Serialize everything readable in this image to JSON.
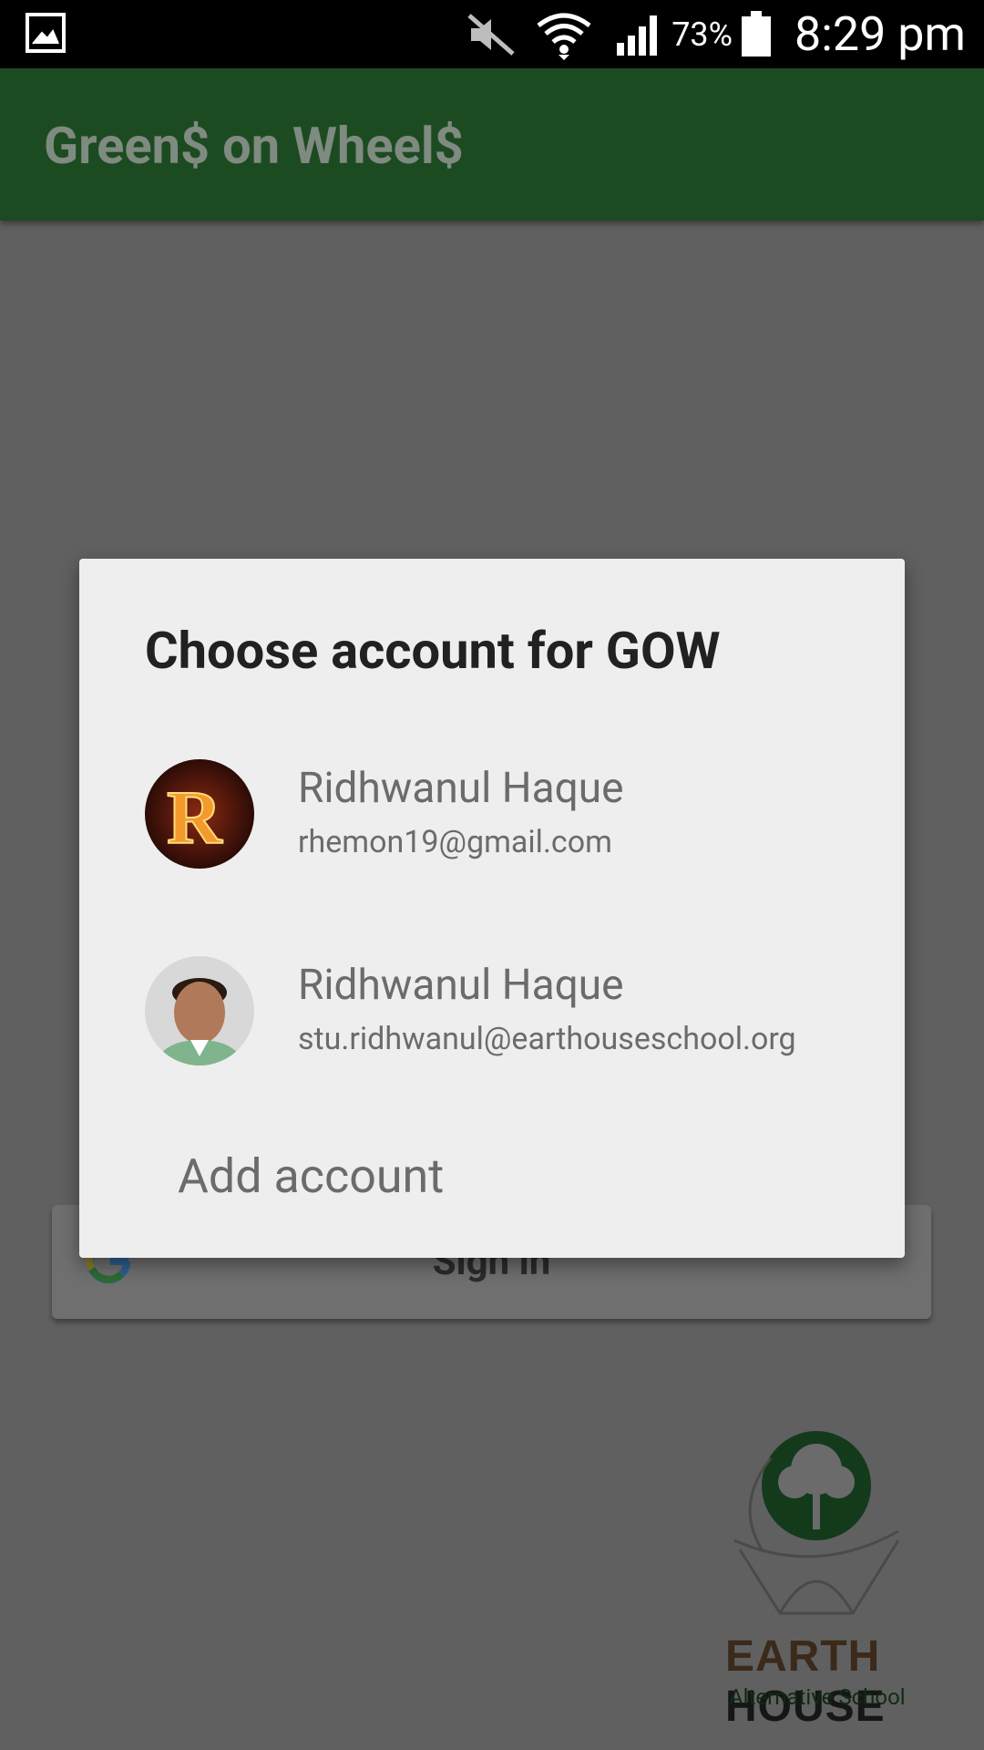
{
  "status_bar": {
    "battery_percent": "73%",
    "time": "8:29 pm",
    "icons": [
      "gallery-icon",
      "mute-icon",
      "wifi-icon",
      "signal-icon",
      "battery-icon"
    ]
  },
  "app_bar": {
    "title": "Green$ on Wheel$"
  },
  "background": {
    "signin_label": "Sign in",
    "logo": {
      "word1": "EARTH",
      "word2": "HOUSE",
      "subtitle": "Alternative School"
    }
  },
  "dialog": {
    "title": "Choose account for GOW",
    "accounts": [
      {
        "name": "Ridhwanul Haque",
        "email": "rhemon19@gmail.com"
      },
      {
        "name": "Ridhwanul Haque",
        "email": "stu.ridhwanul@earthouseschool.org"
      }
    ],
    "add_account_label": "Add account"
  },
  "colors": {
    "app_bar": "#1d4b21",
    "dialog_bg": "#eeeeee",
    "scrim_bg": "#606060"
  }
}
